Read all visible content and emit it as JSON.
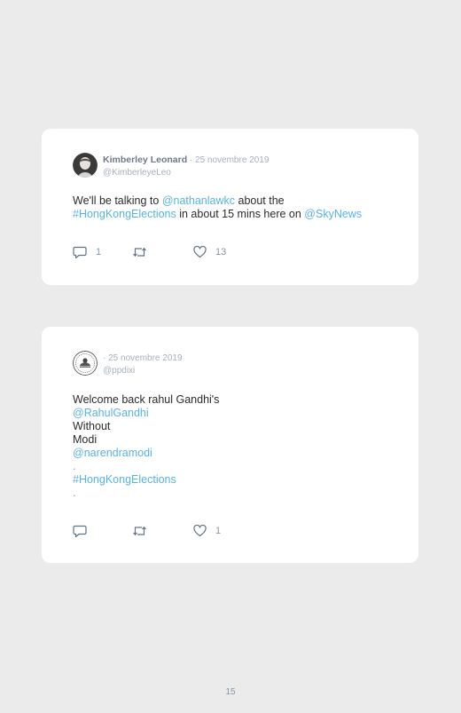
{
  "tweets": [
    {
      "author_name": "Kimberley Leonard",
      "separator": " · ",
      "date": "25 novembre 2019",
      "handle": "@KimberleyeLeo",
      "text": {
        "l1a": "We'll be talking to ",
        "l1b": "@nathanlawkc",
        "l1c": " about the",
        "l2a": "#HongKongElections",
        "l2b": " in about 15 mins here on ",
        "l2c": "@SkyNews"
      },
      "reply_count": "1",
      "retweet_count": "",
      "like_count": "13"
    },
    {
      "author_name": "",
      "separator": "· ",
      "date": "25 novembre 2019",
      "handle": "@ppdixi",
      "text": {
        "line1": "Welcome back rahul Gandhi's",
        "line2": "@RahulGandhi",
        "line3": "Without",
        "line4": "Modi",
        "line5": "@narendramodi",
        "line6": ".",
        "line7": "#HongKongElections",
        "line8": "."
      },
      "reply_count": "",
      "retweet_count": "",
      "like_count": "1"
    }
  ],
  "page_number": "15",
  "colors": {
    "background": "#ebebeb",
    "card": "#ffffff",
    "link": "#57b3e3",
    "name": "#6b7a8c",
    "meta": "#a6b0bc",
    "icon": "#607386"
  },
  "icons": [
    "reply-icon",
    "retweet-icon",
    "like-icon"
  ]
}
